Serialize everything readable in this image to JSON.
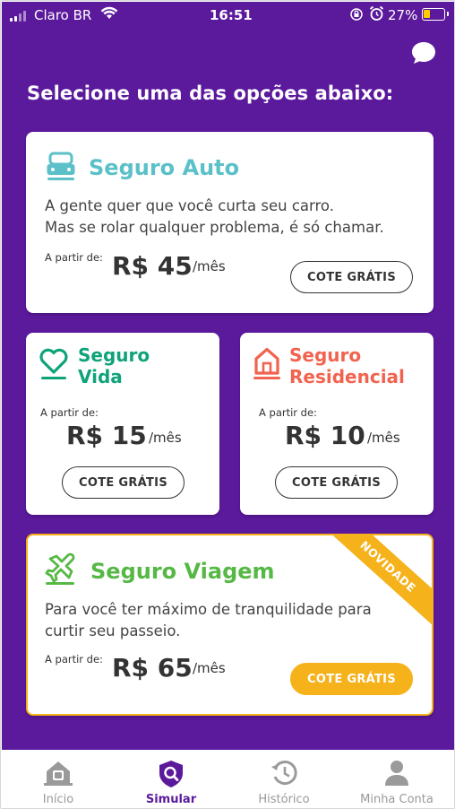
{
  "status_bar": {
    "carrier": "Claro BR",
    "time": "16:51",
    "battery": "27%"
  },
  "colors": {
    "brand_purple": "#5b199c",
    "auto": "#5bc0c8",
    "vida": "#0fa37a",
    "residencial": "#f1634f",
    "viagem": "#56b845",
    "highlight": "#f5b21b"
  },
  "page": {
    "title": "Selecione uma das opções abaixo:"
  },
  "cards": {
    "auto": {
      "icon": "car-icon",
      "title": "Seguro Auto",
      "desc_line1": "A gente quer que você curta seu carro.",
      "desc_line2": "Mas se rolar qualquer problema, é só chamar.",
      "from": "A partir de:",
      "price": "R$ 45",
      "period": "/mês",
      "button": "COTE GRÁTIS"
    },
    "vida": {
      "icon": "heart-icon",
      "title_line1": "Seguro",
      "title_line2": "Vida",
      "from": "A partir de:",
      "price": "R$ 15",
      "period": "/mês",
      "button": "COTE GRÁTIS"
    },
    "residencial": {
      "icon": "house-icon",
      "title_line1": "Seguro",
      "title_line2": "Residencial",
      "from": "A partir de:",
      "price": "R$ 10",
      "period": "/mês",
      "button": "COTE GRÁTIS"
    },
    "viagem": {
      "icon": "airplane-icon",
      "title": "Seguro Viagem",
      "desc_line1": "Para você ter máximo de tranquilidade para",
      "desc_line2": "curtir seu passeio.",
      "from": "A partir de:",
      "price": "R$ 65",
      "period": "/mês",
      "button": "COTE GRÁTIS",
      "badge": "NOVIDADE"
    }
  },
  "tabbar": {
    "items": [
      {
        "label": "Início",
        "icon": "home-icon"
      },
      {
        "label": "Simular",
        "icon": "shield-search-icon"
      },
      {
        "label": "Histórico",
        "icon": "history-icon"
      },
      {
        "label": "Minha Conta",
        "icon": "user-icon"
      }
    ]
  }
}
